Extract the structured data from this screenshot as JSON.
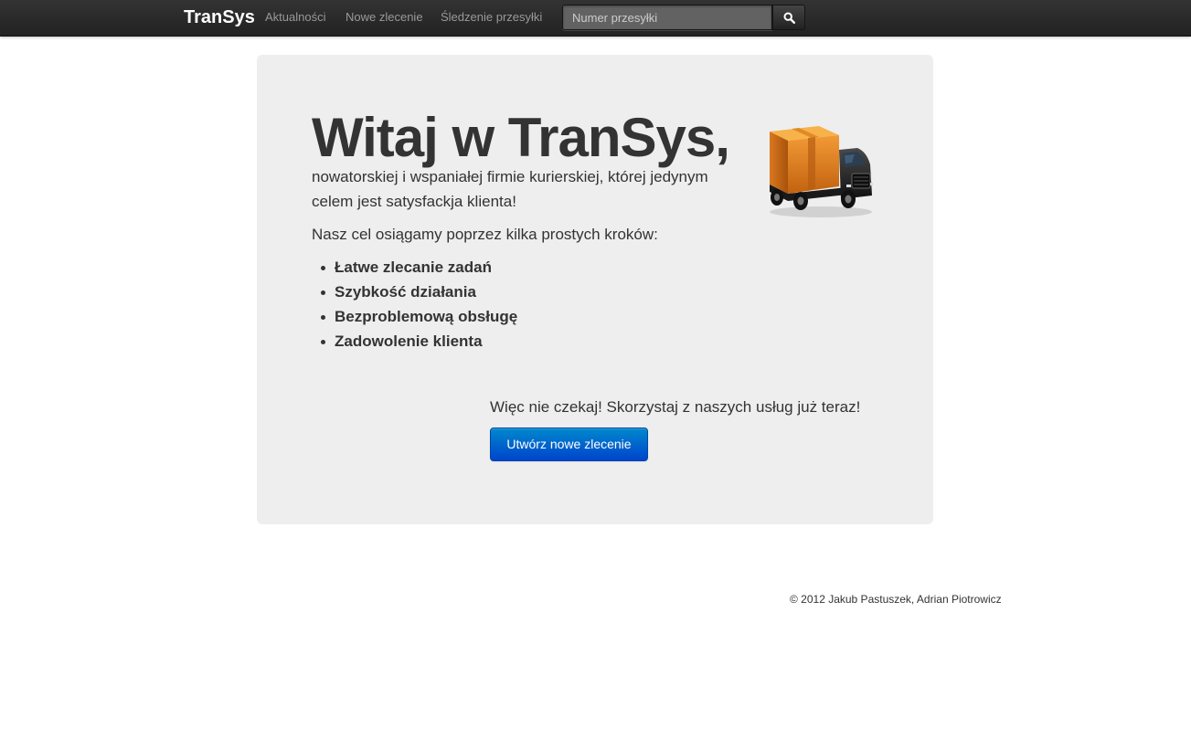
{
  "navbar": {
    "brand": "TranSys",
    "links": [
      {
        "label": "Aktualności"
      },
      {
        "label": "Nowe zlecenie"
      },
      {
        "label": "Śledzenie przesyłki"
      }
    ],
    "search": {
      "placeholder": "Numer przesyłki",
      "value": "",
      "button_icon": "search-icon"
    }
  },
  "hero": {
    "title": "Witaj w TranSys,",
    "subtitle": "nowatorskiej i wspaniałej firmie kurierskiej, której jedynym celem jest satysfackja klienta!",
    "steps_intro": "Nasz cel osiągamy poprzez kilka prostych kroków:",
    "steps": [
      "Łatwe zlecanie zadań",
      "Szybkość działania",
      "Bezproblemową obsługę",
      "Zadowolenie klienta"
    ],
    "image_icon": "delivery-truck-icon",
    "cta_text": "Więc nie czekaj! Skorzystaj z naszych usług już teraz!",
    "cta_button": "Utwórz nowe zlecenie"
  },
  "footer": {
    "copyright": "© 2012 Jakub Pastuszek, Adrian Piotrowicz"
  },
  "colors": {
    "navbar_bg": "#222222",
    "hero_bg": "#eeeeee",
    "primary_button": "#0066cc",
    "text": "#333333"
  }
}
